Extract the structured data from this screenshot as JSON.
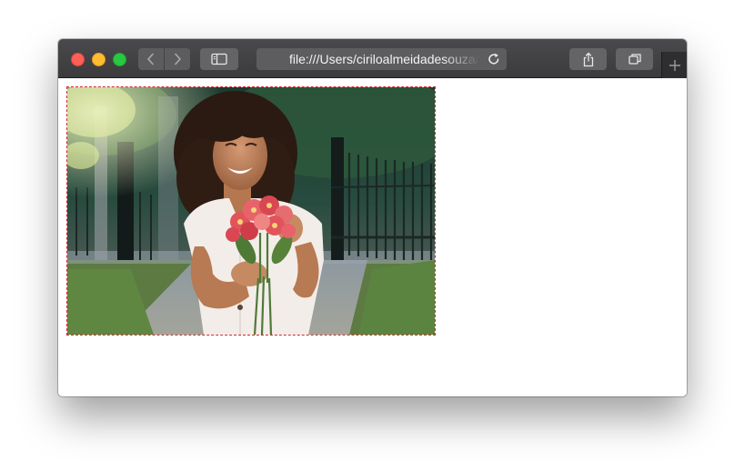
{
  "browser": {
    "address_url": "file:///Users/ciriloalmeidadesouza/",
    "icons": {
      "close": "close-dot",
      "minimize": "minimize-dot",
      "maximize": "maximize-dot",
      "back": "chevron-left-icon",
      "forward": "chevron-right-icon",
      "sidebar": "sidebar-icon",
      "reload": "reload-icon",
      "share": "share-icon",
      "tabs": "tabs-icon",
      "new_tab": "plus-icon"
    },
    "colors": {
      "close": "#fe5f57",
      "minimize": "#febc2e",
      "maximize": "#28c840",
      "frame_border": "#d22b2b"
    }
  },
  "page": {
    "image": {
      "subject": "smiling woman with curly hair holding a bouquet of red flowers"
    }
  }
}
